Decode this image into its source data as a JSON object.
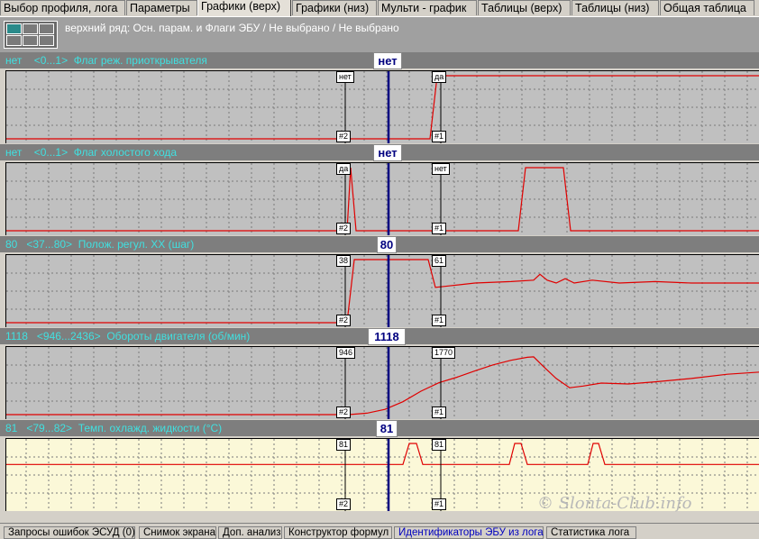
{
  "tabs": [
    {
      "label": "Выбор профиля, лога"
    },
    {
      "label": "Параметры"
    },
    {
      "label": "Графики (верх)"
    },
    {
      "label": "Графики (низ)"
    },
    {
      "label": "Мульти - график"
    },
    {
      "label": "Таблицы (верх)"
    },
    {
      "label": "Таблицы (низ)"
    },
    {
      "label": "Общая таблица"
    }
  ],
  "active_tab": "Графики (верх)",
  "toolbar": {
    "title": "верхний ряд: Осн. парам. и Флаги ЭБУ / Не выбрано / Не выбрано"
  },
  "panels": [
    {
      "header": "нет    <0...1>  Флаг реж. приоткрывателя",
      "cursor_value": "нет",
      "marker_left_top": "нет",
      "marker_right_top": "да",
      "marker_left_bottom": "#2",
      "marker_right_bottom": "#1",
      "min": 0,
      "max": 1,
      "series": [
        [
          0,
          0
        ],
        [
          470,
          0
        ],
        [
          478,
          1
        ],
        [
          836,
          1
        ]
      ]
    },
    {
      "header": "нет    <0...1>  Флаг холостого хода",
      "cursor_value": "нет",
      "marker_left_top": "да",
      "marker_right_top": "нет",
      "marker_left_bottom": "#2",
      "marker_right_bottom": "#1",
      "min": 0,
      "max": 1,
      "series": [
        [
          0,
          0
        ],
        [
          378,
          0
        ],
        [
          382,
          1
        ],
        [
          388,
          0
        ],
        [
          568,
          0
        ],
        [
          576,
          1
        ],
        [
          618,
          1
        ],
        [
          626,
          0
        ],
        [
          836,
          0
        ]
      ]
    },
    {
      "header": "80   <37...80>  Полож. регул. ХХ (шаг)",
      "cursor_value": "80",
      "marker_left_top": "38",
      "marker_right_top": "61",
      "marker_left_bottom": "#2",
      "marker_right_bottom": "#1",
      "min": 37,
      "max": 80,
      "series": [
        [
          0,
          37
        ],
        [
          378,
          37
        ],
        [
          386,
          80
        ],
        [
          468,
          80
        ],
        [
          476,
          61
        ],
        [
          490,
          62
        ],
        [
          520,
          64
        ],
        [
          560,
          65
        ],
        [
          585,
          66
        ],
        [
          592,
          70
        ],
        [
          600,
          66
        ],
        [
          610,
          64
        ],
        [
          620,
          67
        ],
        [
          630,
          64
        ],
        [
          650,
          66
        ],
        [
          680,
          64
        ],
        [
          720,
          65
        ],
        [
          760,
          64
        ],
        [
          836,
          64
        ]
      ]
    },
    {
      "header": "1118   <946...2436>  Обороты двигателя (об/мин)",
      "cursor_value": "1118",
      "marker_left_top": "946",
      "marker_right_top": "1770",
      "marker_left_bottom": "#2",
      "marker_right_bottom": "#1",
      "min": 946,
      "max": 2436,
      "series": [
        [
          0,
          946
        ],
        [
          380,
          946
        ],
        [
          400,
          980
        ],
        [
          420,
          1070
        ],
        [
          440,
          1250
        ],
        [
          460,
          1500
        ],
        [
          480,
          1700
        ],
        [
          500,
          1830
        ],
        [
          520,
          1980
        ],
        [
          540,
          2120
        ],
        [
          560,
          2230
        ],
        [
          578,
          2300
        ],
        [
          585,
          2310
        ],
        [
          595,
          2100
        ],
        [
          610,
          1800
        ],
        [
          625,
          1580
        ],
        [
          640,
          1620
        ],
        [
          660,
          1690
        ],
        [
          690,
          1670
        ],
        [
          720,
          1720
        ],
        [
          760,
          1800
        ],
        [
          800,
          1900
        ],
        [
          836,
          1950
        ]
      ]
    },
    {
      "header": "81   <79...82>  Темп. охлажд. жидкости (°C)",
      "cursor_value": "81",
      "marker_left_top": "81",
      "marker_right_top": "81",
      "marker_left_bottom": "#2",
      "marker_right_bottom": "#1",
      "min": 79,
      "max": 82,
      "series": [
        [
          0,
          81
        ],
        [
          440,
          81
        ],
        [
          447,
          82
        ],
        [
          455,
          82
        ],
        [
          462,
          81
        ],
        [
          558,
          81
        ],
        [
          564,
          82
        ],
        [
          571,
          82
        ],
        [
          578,
          81
        ],
        [
          645,
          81
        ],
        [
          651,
          82
        ],
        [
          657,
          82
        ],
        [
          664,
          81
        ],
        [
          836,
          81
        ]
      ]
    }
  ],
  "bottom_tabs": [
    {
      "label": "Запросы ошибок ЭСУД (0)"
    },
    {
      "label": "Снимок экрана"
    },
    {
      "label": "Доп. анализ"
    },
    {
      "label": "Конструктор формул"
    },
    {
      "label": "Идентификаторы ЭБУ из лога"
    },
    {
      "label": "Статистика лога"
    }
  ],
  "watermark": "© Slonta-Club.info",
  "colors": {
    "signal": "#e00000",
    "cursor": "#000080",
    "header_text": "#40e0e0"
  }
}
